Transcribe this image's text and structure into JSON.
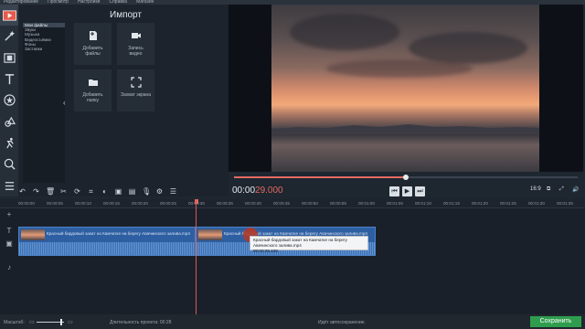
{
  "menu": [
    "Редактирование",
    "Просмотр",
    "Настройки",
    "Справка",
    "Магазин"
  ],
  "import": {
    "title": "Импорт",
    "categories": [
      "Мои файлы",
      "Звуки",
      "Музыка",
      "Видеосъёмки",
      "Фоны",
      "Заставки"
    ],
    "tiles": [
      {
        "label": "Добавить\nфайлы",
        "icon": "add-file-icon"
      },
      {
        "label": "Запись\nвидео",
        "icon": "camera-icon"
      },
      {
        "label": "Добавить\nпапку",
        "icon": "folder-icon"
      },
      {
        "label": "Захват экрана",
        "icon": "screen-capture-icon"
      }
    ]
  },
  "preview": {
    "timecode_current": "00:00",
    "timecode_total": "29.000",
    "progress": 0.5,
    "aspect": "16:9"
  },
  "timeline": {
    "ruler": [
      "00:00:00",
      "00:00:05",
      "00:00:10",
      "00:00:15",
      "00:00:20",
      "00:00:25",
      "00:00:30",
      "00:00:35",
      "00:00:40",
      "00:00:45",
      "00:00:50",
      "00:00:55",
      "00:01:00",
      "00:01:05",
      "00:01:10",
      "00:01:15",
      "00:01:20",
      "00:01:25",
      "00:01:30",
      "00:01:35"
    ],
    "clip_title": "Красный бардовый закат на Камчатке на берегу Авачинского залива.mp4",
    "tooltip_title": "Красный бардовый закат на Камчатке на берегу Авачинского залива.mp4",
    "tooltip_time": "00:00:29.428"
  },
  "status": {
    "zoom_label": "Масштаб:",
    "duration": "Длительность проекта: 00:28",
    "autosave": "Идёт автосохранение.",
    "save_button": "Сохранить"
  }
}
